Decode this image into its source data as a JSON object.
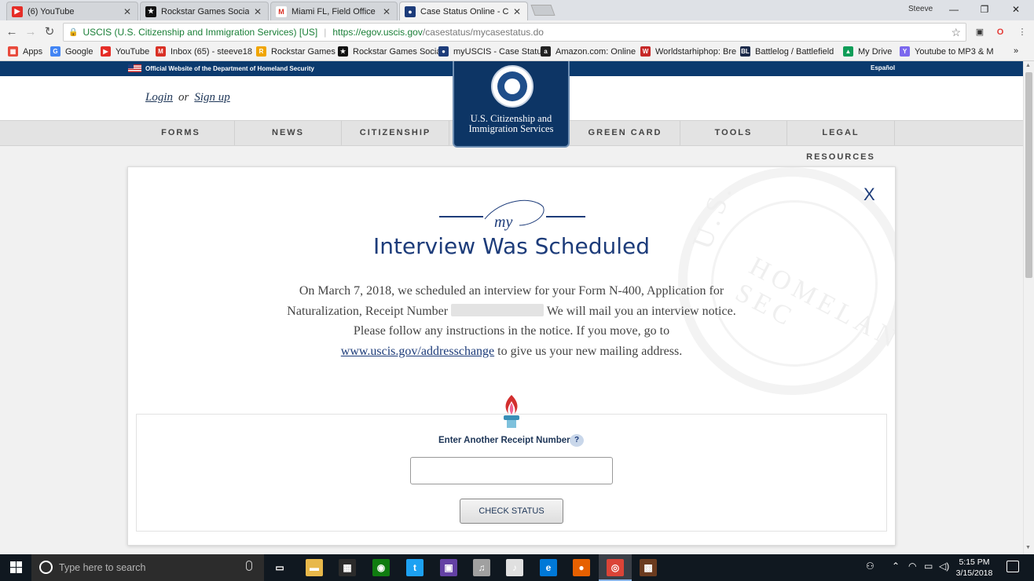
{
  "browser": {
    "tabs": [
      {
        "title": "(6) YouTube",
        "icon": "youtube-icon",
        "color": "#e52d27",
        "glyph": "▶"
      },
      {
        "title": "Rockstar Games Social Cl",
        "icon": "rockstar-icon",
        "color": "#111111",
        "glyph": "★"
      },
      {
        "title": "Miami FL, Field Office File",
        "icon": "gmail-icon",
        "color": "#ffffff",
        "glyph": "M"
      },
      {
        "title": "Case Status Online - Case",
        "icon": "uscis-seal-icon",
        "color": "#1d3c7a",
        "glyph": "●"
      }
    ],
    "profile_name": "Steeve",
    "window_controls": {
      "minimize": "—",
      "restore": "❐",
      "close": "✕"
    },
    "nav": {
      "back": "←",
      "forward": "→",
      "reload": "↻"
    },
    "site_name": "USCIS (U.S. Citizenship and Immigration Services) [US]",
    "url_host": "https://egov.uscis.gov",
    "url_path": "/casestatus/mycasestatus.do",
    "bookmarks": [
      {
        "label": "Apps",
        "icon": "apps-grid-icon",
        "color": "#e84a3c",
        "glyph": "▦"
      },
      {
        "label": "Google",
        "icon": "google-icon",
        "color": "#4285f4",
        "glyph": "G"
      },
      {
        "label": "YouTube",
        "icon": "youtube-icon",
        "color": "#e52d27",
        "glyph": "▶"
      },
      {
        "label": "Inbox (65) - steeve18",
        "icon": "gmail-icon",
        "color": "#d93025",
        "glyph": "M"
      },
      {
        "label": "Rockstar Games",
        "icon": "rockstar-icon",
        "color": "#f0a500",
        "glyph": "R"
      },
      {
        "label": "Rockstar Games Socia",
        "icon": "rockstar-social-icon",
        "color": "#111111",
        "glyph": "★"
      },
      {
        "label": "myUSCIS - Case Statu",
        "icon": "uscis-seal-icon",
        "color": "#1d3c7a",
        "glyph": "●"
      },
      {
        "label": "Amazon.com: Online",
        "icon": "amazon-icon",
        "color": "#222222",
        "glyph": "a"
      },
      {
        "label": "Worldstarhiphop: Bre",
        "icon": "worldstar-icon",
        "color": "#c62828",
        "glyph": "W"
      },
      {
        "label": "Battlelog / Battlefield",
        "icon": "battlelog-icon",
        "color": "#1b2a4a",
        "glyph": "BL"
      },
      {
        "label": "My Drive",
        "icon": "google-drive-icon",
        "color": "#0f9d58",
        "glyph": "▲"
      },
      {
        "label": "Youtube to MP3 & M",
        "icon": "yt-mp3-icon",
        "color": "#7b68ee",
        "glyph": "Y"
      }
    ],
    "bookmarks_overflow": "»"
  },
  "header": {
    "official_text": "Official Website of the Department of Homeland Security",
    "espanol": "Español",
    "login": "Login",
    "or": "or",
    "signup": "Sign up",
    "agency_line1": "U.S. Citizenship and",
    "agency_line2": "Immigration Services",
    "nav": [
      "FORMS",
      "NEWS",
      "CITIZENSHIP",
      "GREEN CARD",
      "TOOLS",
      "LEGAL RESOURCES"
    ]
  },
  "case": {
    "close": "X",
    "logo_text": "my",
    "title": "Interview Was Scheduled",
    "body_part1": "On March 7, 2018, we scheduled an interview for your Form N-400, Application for Naturalization, Receipt Number",
    "body_part2": "We will mail you an interview notice. Please follow any instructions in the notice. If you move, go to",
    "address_link": "www.uscis.gov/addresschange",
    "body_part3": "to give us your new mailing address.",
    "receipt_label": "Enter Another Receipt Number",
    "help": "?",
    "receipt_value": "",
    "check_button": "CHECK STATUS",
    "watermark_left": "U.S.",
    "watermark_bottom": "HOMELAND SEC"
  },
  "taskbar": {
    "search_placeholder": "Type here to search",
    "apps": [
      {
        "name": "task-view-icon",
        "glyph": "▭",
        "color": "#101820"
      },
      {
        "name": "file-explorer-icon",
        "glyph": "▬",
        "color": "#e8b84a"
      },
      {
        "name": "store-icon",
        "glyph": "▦",
        "color": "#2b2b2b"
      },
      {
        "name": "xbox-icon",
        "glyph": "◉",
        "color": "#107c10"
      },
      {
        "name": "twitter-icon",
        "glyph": "t",
        "color": "#1da1f2"
      },
      {
        "name": "twitch-icon",
        "glyph": "▣",
        "color": "#6441a4"
      },
      {
        "name": "groove-icon",
        "glyph": "♫",
        "color": "#a0a0a0"
      },
      {
        "name": "itunes-icon",
        "glyph": "♪",
        "color": "#e0e0e0"
      },
      {
        "name": "edge-icon",
        "glyph": "e",
        "color": "#0078d7"
      },
      {
        "name": "firefox-icon",
        "glyph": "●",
        "color": "#e66000"
      },
      {
        "name": "chrome-icon",
        "glyph": "◎",
        "color": "#db4437"
      },
      {
        "name": "game-app-icon",
        "glyph": "▩",
        "color": "#6b3b1f"
      }
    ],
    "time": "5:15 PM",
    "date": "3/15/2018"
  }
}
